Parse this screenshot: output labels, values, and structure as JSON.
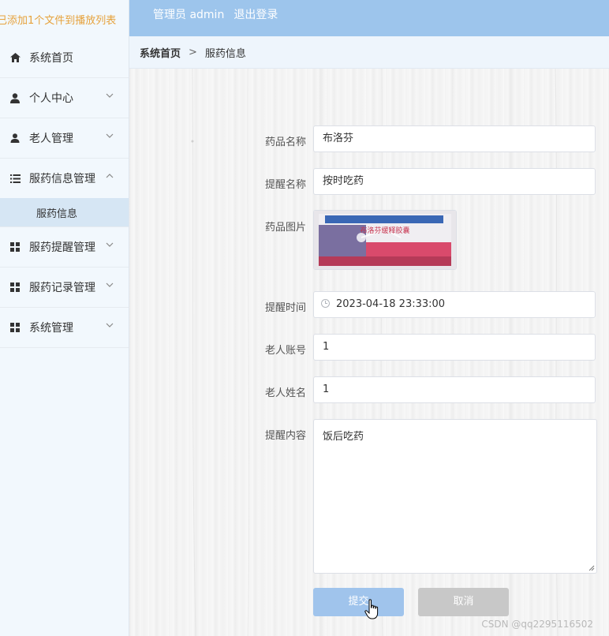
{
  "sidebar": {
    "notice": "已添加1个文件到播放列表",
    "items": [
      {
        "label": "系统首页",
        "icon": "home-icon",
        "expandable": false
      },
      {
        "label": "个人中心",
        "icon": "user-icon",
        "expandable": true
      },
      {
        "label": "老人管理",
        "icon": "user-icon",
        "expandable": true
      },
      {
        "label": "服药信息管理",
        "icon": "list-icon",
        "expandable": true,
        "expanded": true
      },
      {
        "label": "服药提醒管理",
        "icon": "grid-icon",
        "expandable": true
      },
      {
        "label": "服药记录管理",
        "icon": "grid-icon",
        "expandable": true
      },
      {
        "label": "系统管理",
        "icon": "grid-icon",
        "expandable": true
      }
    ],
    "submenu_active": "服药信息"
  },
  "header": {
    "role": "管理员 admin",
    "logout": "退出登录"
  },
  "breadcrumb": {
    "home": "系统首页",
    "separator": ">",
    "current": "服药信息"
  },
  "form": {
    "drug_name": {
      "label": "药品名称",
      "value": "布洛芬"
    },
    "reminder_name": {
      "label": "提醒名称",
      "value": "按时吃药"
    },
    "drug_image": {
      "label": "药品图片",
      "image_text": "布洛芬缓释胶囊"
    },
    "reminder_time": {
      "label": "提醒时间",
      "value": "2023-04-18 23:33:00"
    },
    "elder_account": {
      "label": "老人账号",
      "value": "1"
    },
    "elder_name": {
      "label": "老人姓名",
      "value": "1"
    },
    "reminder_content": {
      "label": "提醒内容",
      "value": "饭后吃药"
    },
    "submit_label": "提交",
    "cancel_label": "取消"
  },
  "watermark": "CSDN @qq2295116502",
  "colors": {
    "header_bg": "#9dc5ec",
    "sidebar_bg": "#f2f8fd",
    "submenu_active_bg": "#d6e6f4",
    "notice_text": "#e6a23c",
    "submit_bg": "#a0c4ec",
    "cancel_bg": "#c8c8c8"
  }
}
